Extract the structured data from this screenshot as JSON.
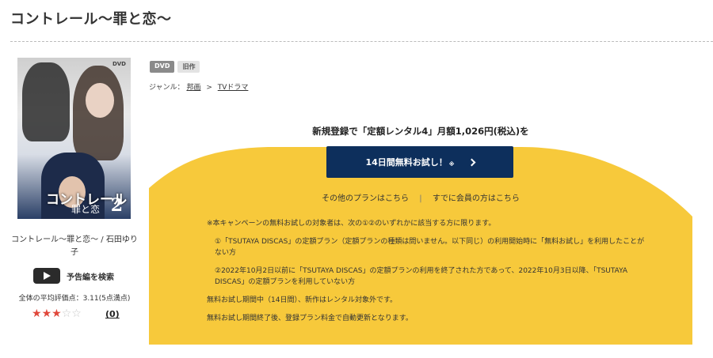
{
  "page": {
    "title": "コントレール〜罪と恋〜"
  },
  "product": {
    "name": "コントレール〜罪と恋〜 / 石田ゆり子",
    "cover_logo": "コントレール",
    "cover_logo_sub": "罪と恋",
    "cover_volume": "2",
    "cover_format": "DVD"
  },
  "trailer": {
    "label": "予告編を検索",
    "icon": "play-icon"
  },
  "rating": {
    "average_label": "全体の平均評価点：3.11(5点満点)",
    "stars_filled": 3,
    "stars_total": 5,
    "review_count": "(0)",
    "star_glyph": "★",
    "star_empty_glyph": "☆"
  },
  "badges": {
    "format": "DVD",
    "category": "旧作"
  },
  "genre": {
    "label": "ジャンル：",
    "items": [
      "邦画",
      "TVドラマ"
    ],
    "separator": ">"
  },
  "promo": {
    "headline": "新規登録で「定額レンタル4」月額1,026円(税込)を",
    "cta_label": "14日間無料お試し！",
    "cta_note": "※",
    "other_plans": "その他のプランはこちら",
    "member_link": "すでに会員の方はこちら",
    "divider": "|",
    "terms": [
      "※本キャンペーンの無料お試しの対象者は、次の①②のいずれかに該当する方に限ります。",
      "①「TSUTAYA DISCAS」の定額プラン（定額プランの種類は問いません。以下同じ）の利用開始時に「無料お試し」を利用したことがない方",
      "②2022年10月2日以前に「TSUTAYA DISCAS」の定額プランの利用を終了された方であって、2022年10月3日以降、「TSUTAYA DISCAS」の定額プランを利用していない方",
      "無料お試し期間中（14日間）、新作はレンタル対象外です。",
      "無料お試し期間終了後、登録プラン料金で自動更新となります。"
    ]
  },
  "colors": {
    "accent_yellow": "#f7c93b",
    "button_navy": "#0d2f5c",
    "star_red": "#e0483b"
  }
}
